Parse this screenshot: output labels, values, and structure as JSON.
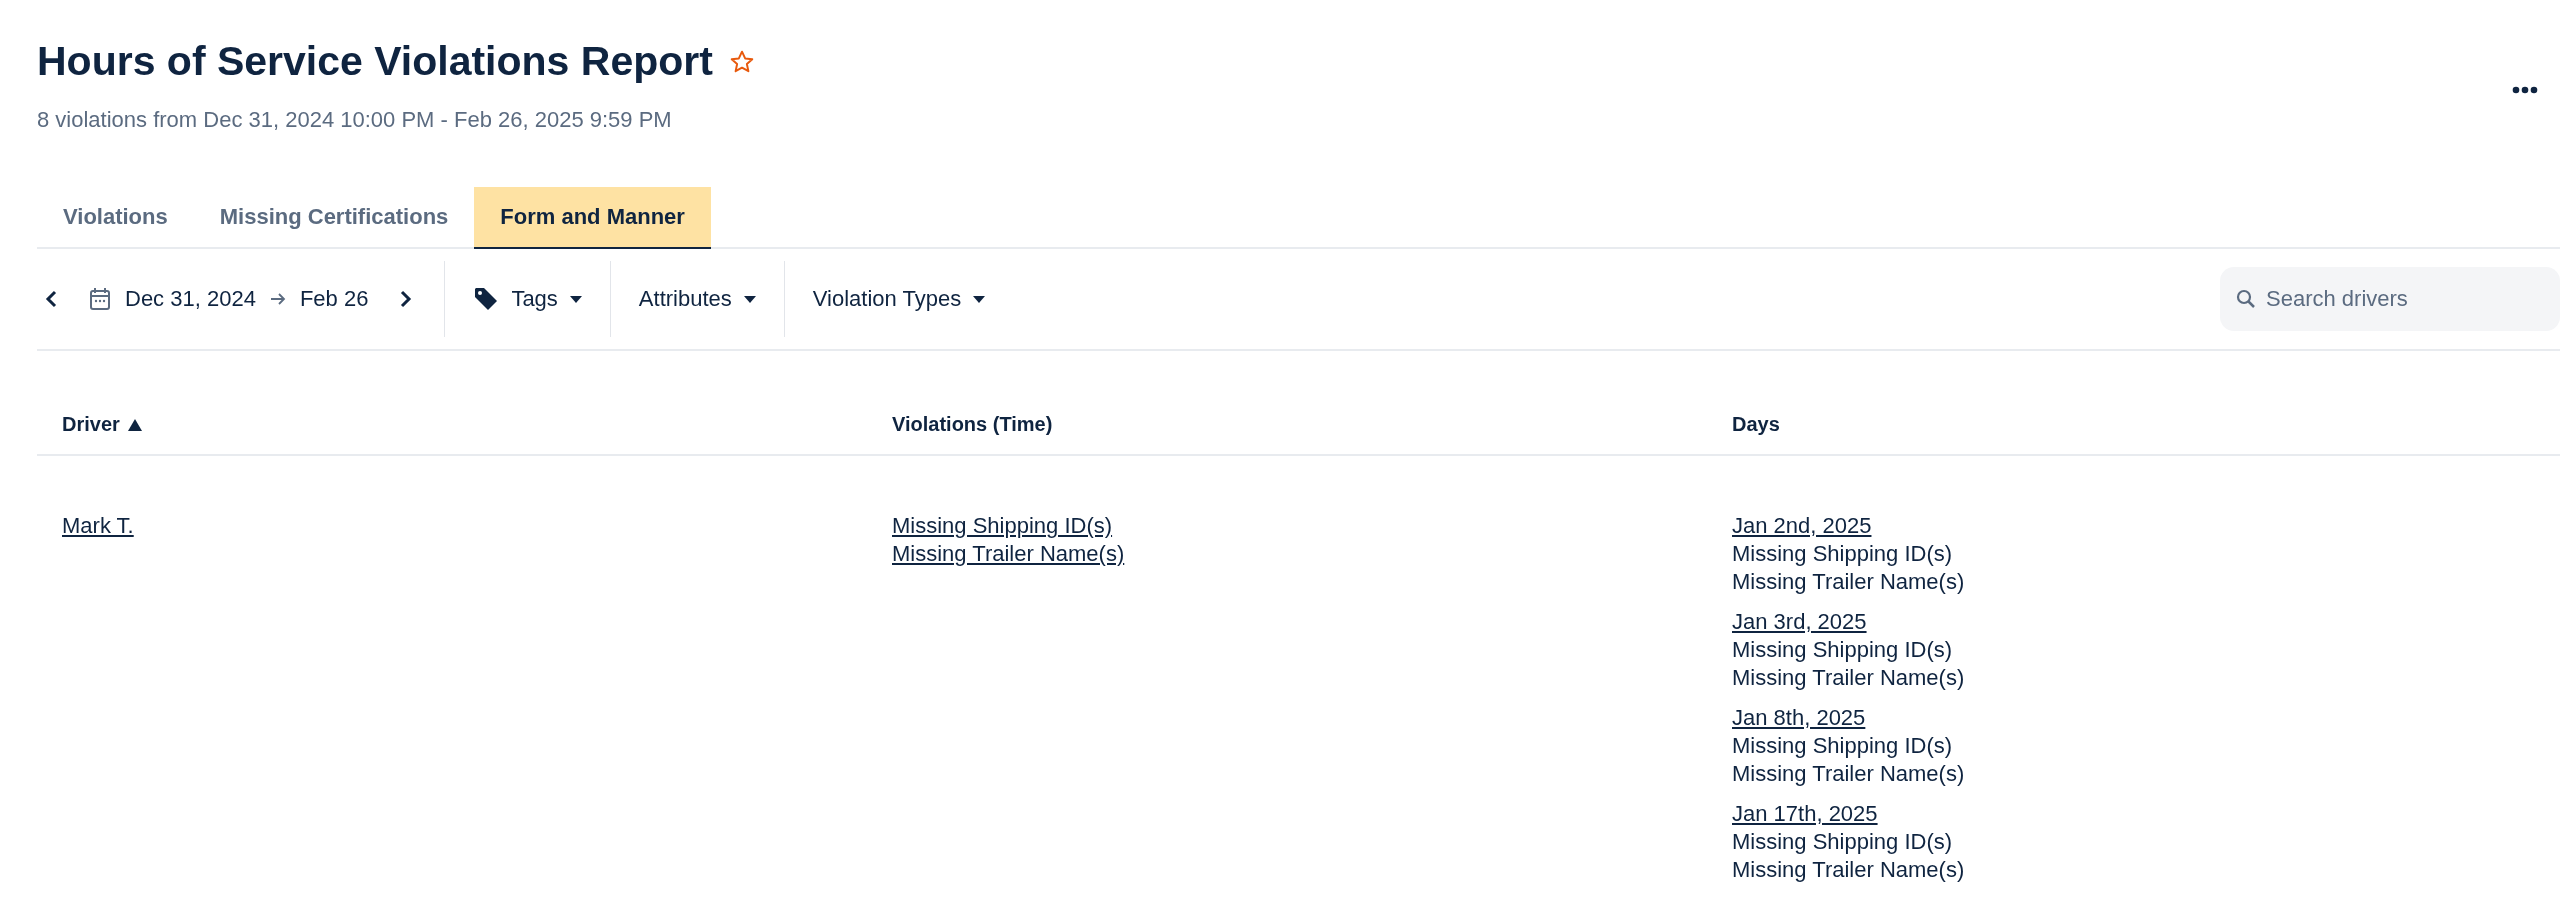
{
  "header": {
    "title": "Hours of Service Violations Report",
    "favorite": false,
    "subtitle": "8 violations from Dec 31, 2024 10:00 PM - Feb 26, 2025 9:59 PM"
  },
  "tabs": [
    {
      "label": "Violations",
      "selected": false
    },
    {
      "label": "Missing Certifications",
      "selected": false
    },
    {
      "label": "Form and Manner",
      "selected": true
    }
  ],
  "toolbar": {
    "date_range": {
      "start": "Dec 31, 2024",
      "end": "Feb 26"
    },
    "filters": [
      "Tags",
      "Attributes",
      "Violation Types"
    ],
    "search": {
      "placeholder": "Search drivers"
    }
  },
  "table": {
    "columns": [
      {
        "label": "Driver",
        "sorted_ascending": true
      },
      {
        "label": "Violations (Time)"
      },
      {
        "label": "Days"
      }
    ],
    "rows": [
      {
        "driver": "Mark T.",
        "violations": [
          "Missing Shipping ID(s)",
          "Missing Trailer Name(s)"
        ],
        "days": [
          {
            "date": "Jan 2nd, 2025",
            "items": [
              "Missing Shipping ID(s)",
              "Missing Trailer Name(s)"
            ]
          },
          {
            "date": "Jan 3rd, 2025",
            "items": [
              "Missing Shipping ID(s)",
              "Missing Trailer Name(s)"
            ]
          },
          {
            "date": "Jan 8th, 2025",
            "items": [
              "Missing Shipping ID(s)",
              "Missing Trailer Name(s)"
            ]
          },
          {
            "date": "Jan 17th, 2025",
            "items": [
              "Missing Shipping ID(s)",
              "Missing Trailer Name(s)"
            ]
          }
        ]
      }
    ]
  }
}
